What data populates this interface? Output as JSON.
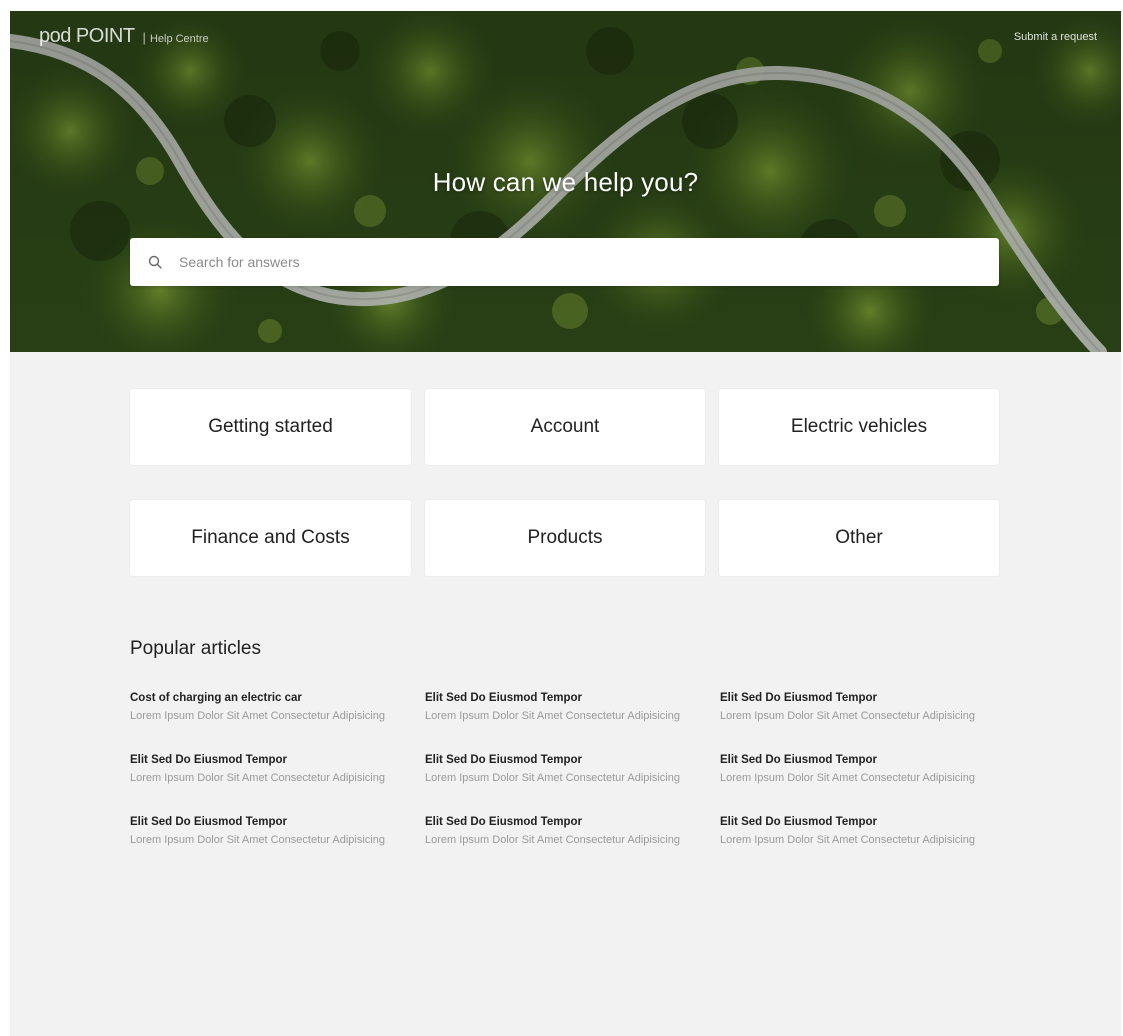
{
  "header": {
    "logo": "pod POINT",
    "separator": "|",
    "subtitle": "Help Centre",
    "link": "Submit a request"
  },
  "hero": {
    "title": "How can we help you?",
    "search_placeholder": "Search for answers"
  },
  "categories": [
    {
      "label": "Getting started"
    },
    {
      "label": "Account"
    },
    {
      "label": "Electric vehicles"
    },
    {
      "label": "Finance and Costs"
    },
    {
      "label": "Products"
    },
    {
      "label": "Other"
    }
  ],
  "popular": {
    "title": "Popular articles",
    "articles": [
      {
        "title": "Cost of charging an electric car",
        "desc": "Lorem Ipsum Dolor Sit Amet Consectetur Adipisicing"
      },
      {
        "title": "Elit Sed Do Eiusmod Tempor",
        "desc": "Lorem Ipsum Dolor Sit Amet Consectetur Adipisicing"
      },
      {
        "title": "Elit Sed Do Eiusmod Tempor",
        "desc": "Lorem Ipsum Dolor Sit Amet Consectetur Adipisicing"
      },
      {
        "title": "Elit Sed Do Eiusmod Tempor",
        "desc": "Lorem Ipsum Dolor Sit Amet Consectetur Adipisicing"
      },
      {
        "title": "Elit Sed Do Eiusmod Tempor",
        "desc": "Lorem Ipsum Dolor Sit Amet Consectetur Adipisicing"
      },
      {
        "title": "Elit Sed Do Eiusmod Tempor",
        "desc": "Lorem Ipsum Dolor Sit Amet Consectetur Adipisicing"
      },
      {
        "title": "Elit Sed Do Eiusmod Tempor",
        "desc": "Lorem Ipsum Dolor Sit Amet Consectetur Adipisicing"
      },
      {
        "title": "Elit Sed Do Eiusmod Tempor",
        "desc": "Lorem Ipsum Dolor Sit Amet Consectetur Adipisicing"
      },
      {
        "title": "Elit Sed Do Eiusmod Tempor",
        "desc": "Lorem Ipsum Dolor Sit Amet Consectetur Adipisicing"
      }
    ]
  },
  "colors": {
    "page_bg": "#f2f2f2",
    "card_bg": "#ffffff",
    "forest_dark": "#1f3312",
    "forest_mid": "#3f5f1f",
    "road": "#b9bdb8"
  },
  "icons": {
    "search": "search-icon"
  }
}
